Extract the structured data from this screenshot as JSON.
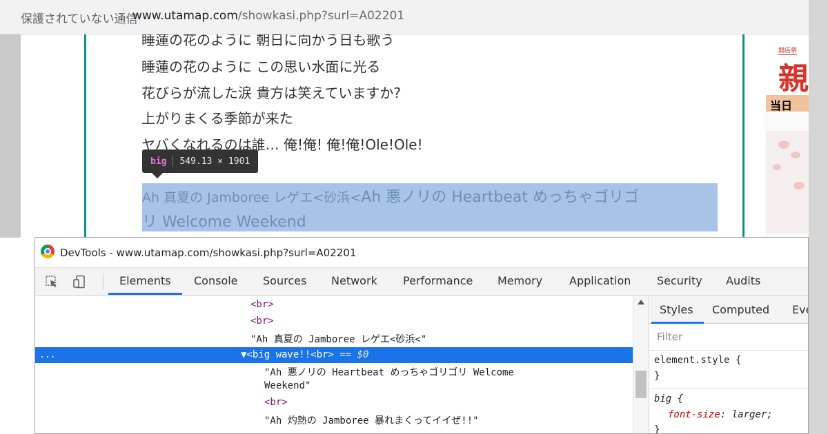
{
  "address_bar": {
    "security_label": "保護されていない通信",
    "url_host": "www.utamap.com",
    "url_path": "/showkasi.php?surl=A02201"
  },
  "lyrics": {
    "lines": [
      "睡蓮の花のように 朝日に向かう日も歌う",
      "睡蓮の花のように この思い水面に光る",
      "花びらが流した涙 貴方は笑えていますか?",
      "上がりまくる季節が来た",
      "ヤバくなれるのは誰… 俺!俺! 俺!俺!Ole!Ole!"
    ],
    "highlight_line1_small": "Ah 真夏の Jamboree レゲエ<砂浜<",
    "highlight_line1_big": "Ah 悪ノリの Heartbeat めっちゃゴリゴ",
    "highlight_line2": "リ Welcome Weekend"
  },
  "tooltip": {
    "tag": "big",
    "dimensions": "549.13 × 1901"
  },
  "ad": {
    "mini_text": "開店祭",
    "big_text": "親",
    "bar_text": "当日"
  },
  "devtools": {
    "title": "DevTools - www.utamap.com/showkasi.php?surl=A02201",
    "tabs": [
      "Elements",
      "Console",
      "Sources",
      "Network",
      "Performance",
      "Memory",
      "Application",
      "Security",
      "Audits"
    ],
    "active_tab": "Elements",
    "dom_lines": {
      "br1": "<br>",
      "br2": "<br>",
      "text1": "\"Ah 真夏の Jamboree レゲエ<砂浜<\"",
      "selected_dots": "...",
      "selected_tag": "▼<big wave!!<br>",
      "selected_suffix": " == $0",
      "text2a": "\"Ah 悪ノリの Heartbeat めっちゃゴリゴリ Welcome",
      "text2b": "Weekend\"",
      "br3": "<br>",
      "text3": "\"Ah 灼熱の Jamboree 暴れまくってイイぜ!!\""
    },
    "styles": {
      "sub_tabs": [
        "Styles",
        "Computed",
        "Eve"
      ],
      "filter_placeholder": "Filter",
      "element_style_open": "element.style {",
      "element_style_close": "}",
      "rule_selector": "big {",
      "rule_prop": "font-size",
      "rule_value": "larger;",
      "rule_close": "}"
    }
  }
}
